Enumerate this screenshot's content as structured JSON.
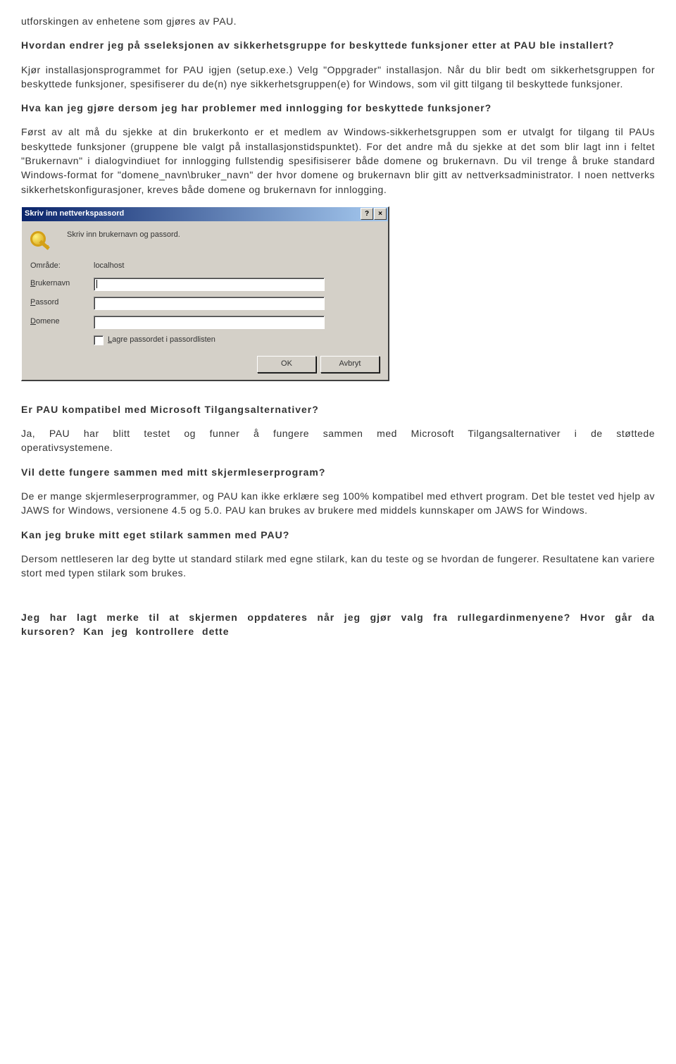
{
  "p1": "utforskingen av enhetene som gjøres av PAU.",
  "q1": "Hvordan endrer jeg på sseleksjonen av sikkerhetsgruppe for beskyttede funksjoner etter at PAU ble installert?",
  "a1": "Kjør installasjonsprogrammet for PAU igjen (setup.exe.) Velg \"Oppgrader\" installasjon. Når du blir bedt om sikkerhetsgruppen for beskyttede funksjoner, spesifiserer du de(n) nye sikkerhetsgruppen(e) for Windows, som vil gitt tilgang til beskyttede funksjoner.",
  "q2": "Hva kan jeg gjøre dersom jeg har problemer med innlogging for beskyttede funksjoner?",
  "a2": "Først av alt må du sjekke at din brukerkonto er et medlem av Windows-sikkerhetsgruppen som er utvalgt for tilgang til PAUs beskyttede funksjoner (gruppene ble valgt på installasjonstidspunktet). For det andre må du sjekke at det som blir lagt inn i feltet \"Brukernavn\" i dialogvindiuet for innlogging fullstendig spesifisiserer både domene og brukernavn. Du vil trenge å bruke standard Windows-format for \"domene_navn\\bruker_navn\" der hvor domene og brukernavn blir gitt av nettverksadministrator. I noen nettverks sikkerhetskonfigurasjoner, kreves både domene og brukernavn for innlogging.",
  "dialog": {
    "title": "Skriv inn nettverkspassord",
    "help_btn": "?",
    "close_btn": "×",
    "instruction": "Skriv inn brukernavn og passord.",
    "labels": {
      "omrade": "Område:",
      "omrade_val": "localhost",
      "bruker_u": "B",
      "bruker_rest": "rukernavn",
      "passord_u": "P",
      "passord_rest": "assord",
      "domene_u": "D",
      "domene_rest": "omene",
      "lagre_u": "L",
      "lagre_rest": "agre passordet i passordlisten"
    },
    "buttons": {
      "ok": "OK",
      "cancel": "Avbryt"
    }
  },
  "q3": "Er PAU kompatibel med Microsoft Tilgangsalternativer?",
  "a3": "Ja, PAU har blitt testet og funner å fungere sammen med Microsoft Tilgangsalternativer i de støttede operativsystemene.",
  "q4": "Vil dette fungere sammen med mitt skjermleserprogram?",
  "a4": "De er mange skjermleserprogrammer, og PAU kan ikke erklære seg 100% kompatibel med ethvert program. Det ble testet ved hjelp av JAWS for Windows, versionene 4.5 og 5.0. PAU kan brukes av brukere med middels kunnskaper om JAWS for Windows.",
  "q5": "Kan jeg bruke mitt eget stilark sammen med PAU?",
  "a5": "Dersom nettleseren lar deg bytte ut standard stilark med egne stilark, kan du teste og se hvordan de fungerer. Resultatene kan variere stort med typen stilark som brukes.",
  "q6": "Jeg har lagt merke til at skjermen oppdateres når jeg gjør valg fra rullegardinmenyene? Hvor går da kursoren? Kan jeg kontrollere dette"
}
